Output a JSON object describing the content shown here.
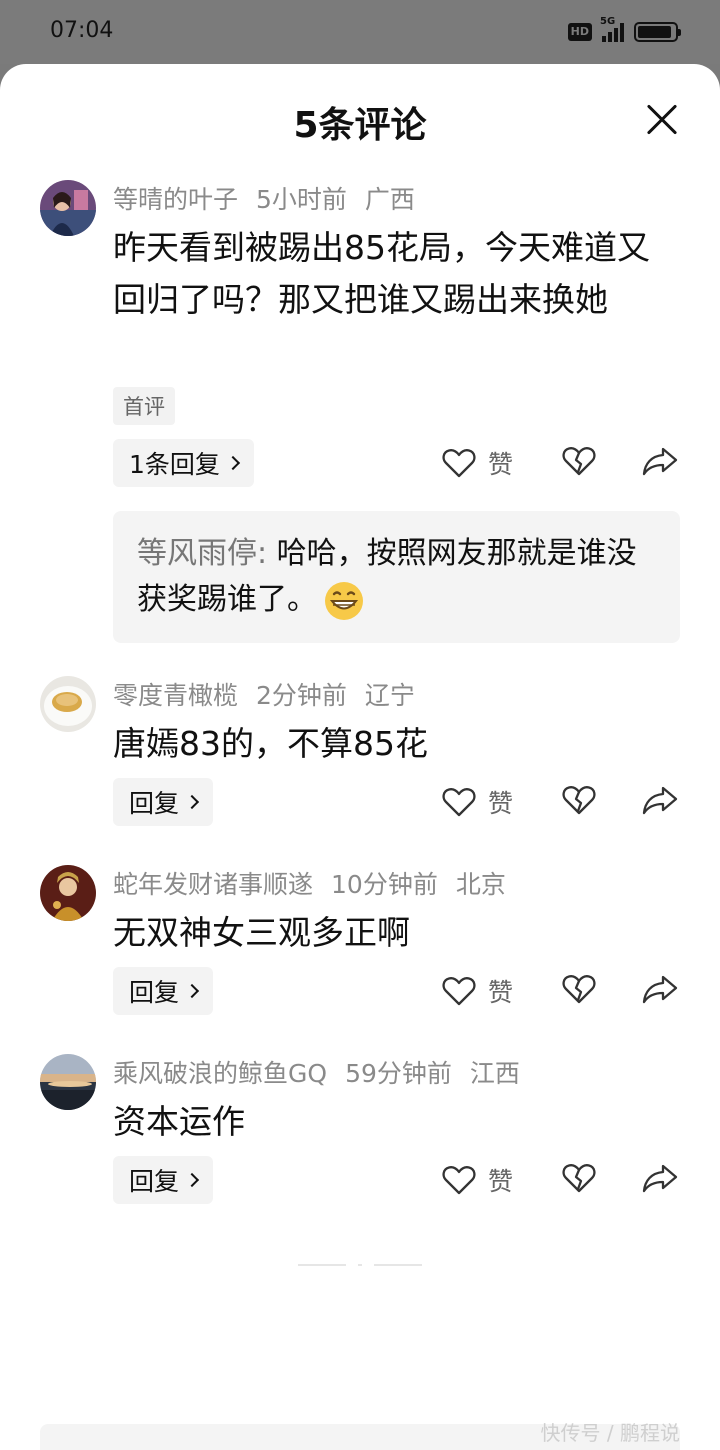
{
  "status_bar": {
    "time": "07:04",
    "hd_label": "HD",
    "network_label": "5G",
    "battery_level": 0.92
  },
  "sheet": {
    "title": "5条评论",
    "close_icon": "close-icon"
  },
  "actions": {
    "like_label": "赞"
  },
  "comments": [
    {
      "author": "等晴的叶子",
      "time": "5小时前",
      "location": "广西",
      "content": "昨天看到被踢出85花局，今天难道又回归了吗？那又把谁又踢出来换她",
      "tag": "首评",
      "reply_label": "1条回复",
      "sub_reply": {
        "author": "等风雨停:",
        "text": "哈哈，按照网友那就是谁没获奖踢谁了。",
        "emoji": "grinning-face-emoji"
      }
    },
    {
      "author": "零度青橄榄",
      "time": "2分钟前",
      "location": "辽宁",
      "content": "唐嫣83的，不算85花",
      "reply_label": "回复"
    },
    {
      "author": "蛇年发财诸事顺遂",
      "time": "10分钟前",
      "location": "北京",
      "content": "无双神女三观多正啊",
      "reply_label": "回复"
    },
    {
      "author": "乘风破浪的鲸鱼GQ",
      "time": "59分钟前",
      "location": "江西",
      "content": "资本运作",
      "reply_label": "回复"
    }
  ],
  "watermark": "快传号 / 鹏程说"
}
